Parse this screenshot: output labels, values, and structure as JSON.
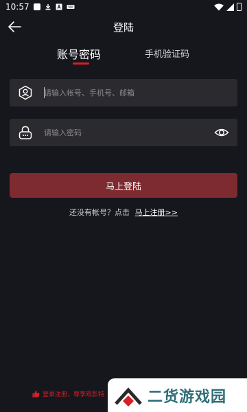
{
  "status_bar": {
    "time": "10:57"
  },
  "header": {
    "title": "登陆"
  },
  "tabs": [
    {
      "label": "账号密码",
      "active": true
    },
    {
      "label": "手机验证码",
      "active": false
    }
  ],
  "form": {
    "account": {
      "placeholder": "请输入帐号、手机号、邮箱",
      "value": ""
    },
    "password": {
      "placeholder": "请输入密码",
      "value": ""
    },
    "login_label": "马上登陆"
  },
  "register": {
    "prompt": "还没有帐号？点击",
    "link_label": "马上注册>>"
  },
  "notice": {
    "text": "登录注册，尊享观影特"
  },
  "watermark": {
    "text": "二货游戏园"
  },
  "colors": {
    "background": "#16171d",
    "field": "#2a2a2f",
    "accent": "#d81e27",
    "button": "#7d2b30"
  }
}
